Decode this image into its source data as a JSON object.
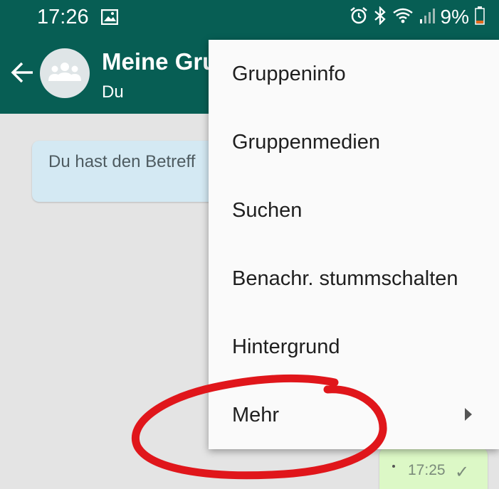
{
  "status_bar": {
    "time": "17:26",
    "battery": "9%",
    "icons": [
      "image-icon",
      "alarm-icon",
      "bluetooth-icon",
      "wifi-icon",
      "signal-icon",
      "battery-icon"
    ]
  },
  "app_bar": {
    "back_icon": "arrow-left-icon",
    "title": "Meine Gru",
    "subtitle": "Du",
    "avatar_icon": "group-icon"
  },
  "chat": {
    "system_message": "Du hast den Betreff",
    "outgoing_time": "17:25",
    "outgoing_status_icon": "check-icon"
  },
  "menu": {
    "items": [
      {
        "label": "Gruppeninfo"
      },
      {
        "label": "Gruppenmedien"
      },
      {
        "label": "Suchen"
      },
      {
        "label": "Benachr. stummschalten"
      },
      {
        "label": "Hintergrund"
      },
      {
        "label": "Mehr",
        "has_submenu": true
      }
    ]
  },
  "colors": {
    "header": "#075e54",
    "chat_background": "#e4e4e4",
    "annotation": "#e0161b",
    "system_bubble": "#d4e9f3",
    "outgoing_bubble": "#dcf8c6"
  }
}
